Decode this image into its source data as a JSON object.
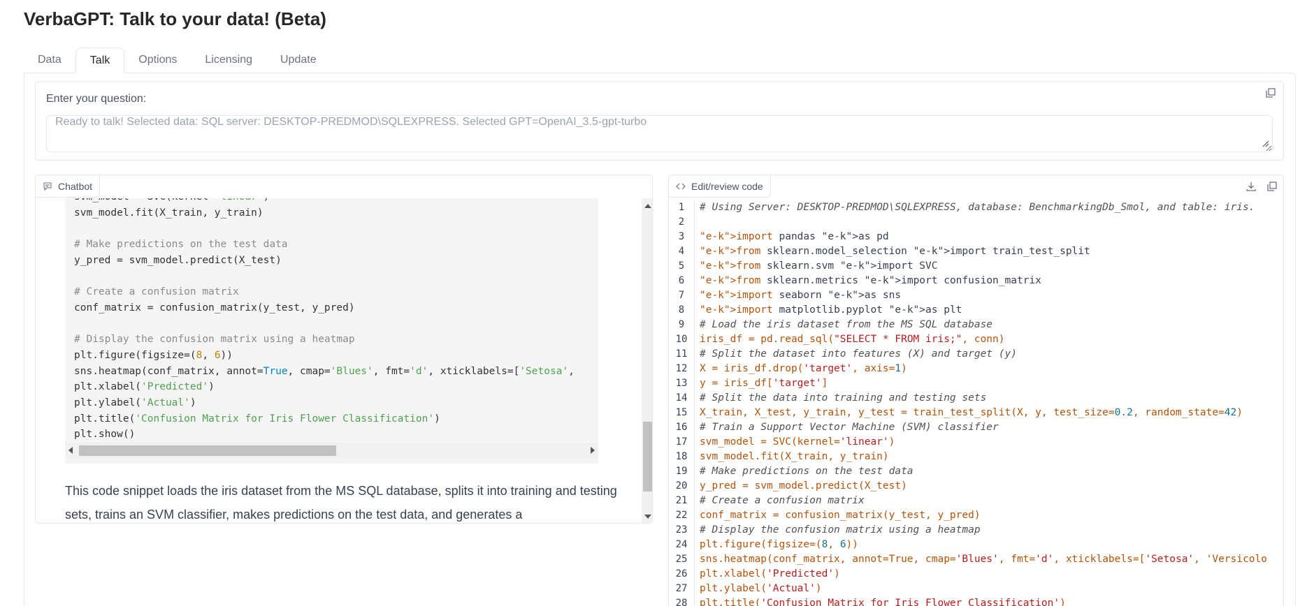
{
  "app": {
    "title": "VerbaGPT: Talk to your data! (Beta)"
  },
  "tabs": [
    {
      "label": "Data",
      "active": false
    },
    {
      "label": "Talk",
      "active": true
    },
    {
      "label": "Options",
      "active": false
    },
    {
      "label": "Licensing",
      "active": false
    },
    {
      "label": "Update",
      "active": false
    }
  ],
  "question": {
    "label": "Enter your question:",
    "placeholder": "Ready to talk! Selected data: SQL server: DESKTOP-PREDMOD\\SQLEXPRESS. Selected GPT=OpenAI_3.5-gpt-turbo",
    "value": ""
  },
  "chatbot": {
    "label": "Chatbot",
    "code_lines": [
      "svm_model = SVC(kernel='linear')",
      "svm_model.fit(X_train, y_train)",
      "",
      "# Make predictions on the test data",
      "y_pred = svm_model.predict(X_test)",
      "",
      "# Create a confusion matrix",
      "conf_matrix = confusion_matrix(y_test, y_pred)",
      "",
      "# Display the confusion matrix using a heatmap",
      "plt.figure(figsize=(8, 6))",
      "sns.heatmap(conf_matrix, annot=True, cmap='Blues', fmt='d', xticklabels=['Setosa',",
      "plt.xlabel('Predicted')",
      "plt.ylabel('Actual')",
      "plt.title('Confusion Matrix for Iris Flower Classification')",
      "plt.show()"
    ],
    "response_text": "This code snippet loads the iris dataset from the MS SQL database, splits it into training and testing sets, trains an SVM classifier, makes predictions on the test data, and generates a"
  },
  "editor": {
    "label": "Edit/review code",
    "lines": [
      "# Using Server: DESKTOP-PREDMOD\\SQLEXPRESS, database: BenchmarkingDb_Smol, and table: iris.",
      "",
      "import pandas as pd",
      "from sklearn.model_selection import train_test_split",
      "from sklearn.svm import SVC",
      "from sklearn.metrics import confusion_matrix",
      "import seaborn as sns",
      "import matplotlib.pyplot as plt",
      "# Load the iris dataset from the MS SQL database",
      "iris_df = pd.read_sql(\"SELECT * FROM iris;\", conn)",
      "# Split the dataset into features (X) and target (y)",
      "X = iris_df.drop('target', axis=1)",
      "y = iris_df['target']",
      "# Split the data into training and testing sets",
      "X_train, X_test, y_train, y_test = train_test_split(X, y, test_size=0.2, random_state=42)",
      "# Train a Support Vector Machine (SVM) classifier",
      "svm_model = SVC(kernel='linear')",
      "svm_model.fit(X_train, y_train)",
      "# Make predictions on the test data",
      "y_pred = svm_model.predict(X_test)",
      "# Create a confusion matrix",
      "conf_matrix = confusion_matrix(y_test, y_pred)",
      "# Display the confusion matrix using a heatmap",
      "plt.figure(figsize=(8, 6))",
      "sns.heatmap(conf_matrix, annot=True, cmap='Blues', fmt='d', xticklabels=['Setosa', 'Versicolo",
      "plt.xlabel('Predicted')",
      "plt.ylabel('Actual')",
      "plt.title('Confusion Matrix for Iris Flower Classification')"
    ]
  },
  "icons": {
    "copy": "copy-icon",
    "download": "download-icon",
    "chat": "chat-icon",
    "code": "code-icon",
    "resize": "resize-grip-icon"
  }
}
